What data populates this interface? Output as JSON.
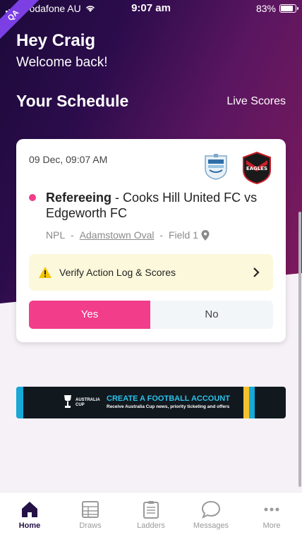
{
  "status_bar": {
    "carrier": "Vodafone AU",
    "time": "9:07 am",
    "battery": "83%",
    "battery_level": 0.83
  },
  "env_badge": "QA",
  "header": {
    "greeting": "Hey Craig",
    "welcome": "Welcome back!"
  },
  "schedule": {
    "title": "Your Schedule",
    "live_scores_label": "Live Scores"
  },
  "match": {
    "datetime": "09 Dec, 09:07 AM",
    "role": "Refereeing",
    "separator": " - ",
    "fixture": "Cooks Hill United FC vs Edgeworth FC",
    "competition": "NPL",
    "venue_sep1": " - ",
    "ground": "Adamstown Oval",
    "venue_sep2": " - ",
    "field": "Field 1",
    "verify_label": "Verify Action Log & Scores",
    "yes_label": "Yes",
    "no_label": "No",
    "away_crest_text": "EAGLES"
  },
  "banner": {
    "brand": "AUSTRALIA CUP",
    "headline": "CREATE A FOOTBALL ACCOUNT",
    "subline": "Receive Australia Cup news, priority ticketing and offers"
  },
  "tabs": [
    {
      "label": "Home",
      "icon": "home-icon",
      "active": true
    },
    {
      "label": "Draws",
      "icon": "draws-icon",
      "active": false
    },
    {
      "label": "Ladders",
      "icon": "ladders-icon",
      "active": false
    },
    {
      "label": "Messages",
      "icon": "messages-icon",
      "active": false
    },
    {
      "label": "More",
      "icon": "more-icon",
      "active": false
    }
  ],
  "colors": {
    "accent": "#f23d8b",
    "hero_dark": "#1c0a3a",
    "hero_magenta": "#7f1a5c",
    "verify_bg": "#fcf8db"
  }
}
